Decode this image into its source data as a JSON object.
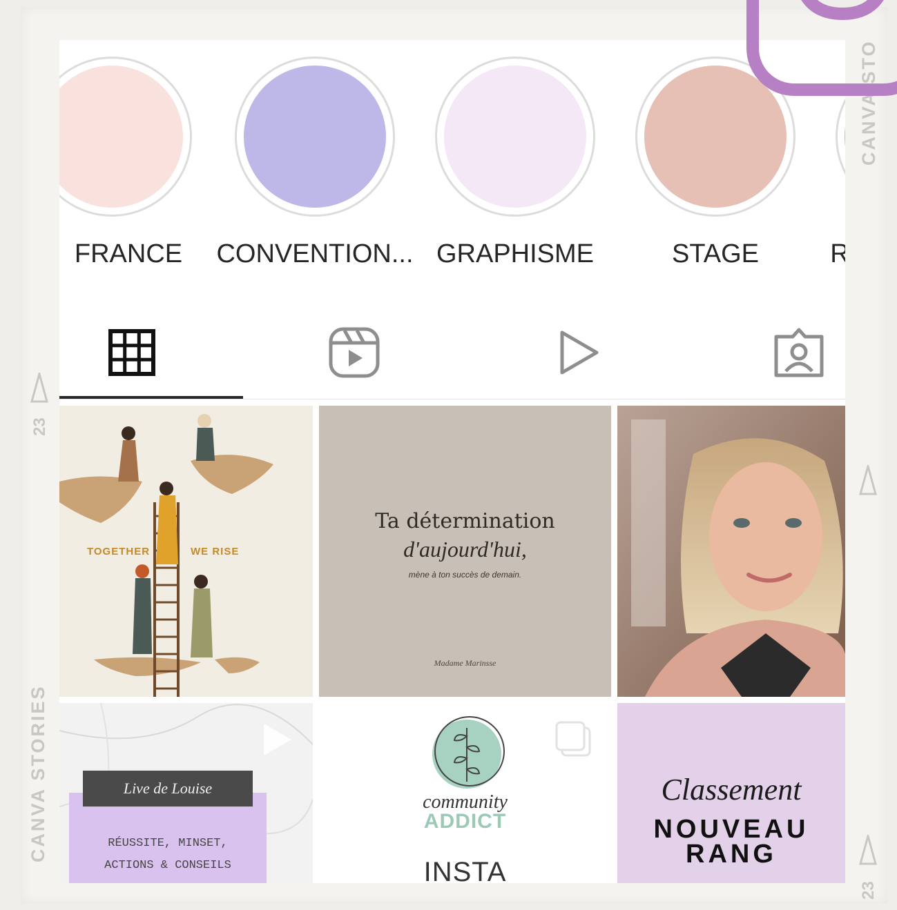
{
  "frame": {
    "watermark_left": "CANVA STORIES",
    "watermark_right": "CANVA STO",
    "page_number_left": "23",
    "page_number_right": "23"
  },
  "highlights": [
    {
      "label": "FRANCE",
      "color": "#f9e2dd"
    },
    {
      "label": "CONVENTION...",
      "color": "#bdb8e8"
    },
    {
      "label": "GRAPHISME",
      "color": "#f4e8f7"
    },
    {
      "label": "STAGE",
      "color": "#e6c0b5"
    },
    {
      "label": "R",
      "color": "#c7aee6"
    }
  ],
  "tabs": [
    {
      "name": "posts-grid",
      "icon": "grid-icon",
      "active": true
    },
    {
      "name": "reels",
      "icon": "reels-icon",
      "active": false
    },
    {
      "name": "videos",
      "icon": "play-icon",
      "active": false
    },
    {
      "name": "tagged",
      "icon": "tagged-person-icon",
      "active": false
    }
  ],
  "posts": {
    "together": {
      "left_word": "TOGETHER",
      "right_word": "WE RISE"
    },
    "quote": {
      "line1": "Ta détermination",
      "line2": "d'aujourd'hui,",
      "line3": "mène à ton succès de demain.",
      "signature": "Madame Marinsse"
    },
    "live": {
      "banner": "Live de Louise",
      "line1": "RÉUSSITE, MINSET,",
      "line2": "ACTIONS & CONSEILS",
      "badge_icon": "play-icon"
    },
    "community": {
      "word1": "community",
      "word2": "ADDICT",
      "word3": "INSTA",
      "badge_icon": "carousel-icon"
    },
    "classement": {
      "title": "Classement",
      "line1": "NOUVEAU",
      "line2": "RANG"
    }
  },
  "colors": {
    "accent": "#b77fc4",
    "tab_active": "#262626",
    "tab_inactive": "#8e8e8e"
  }
}
